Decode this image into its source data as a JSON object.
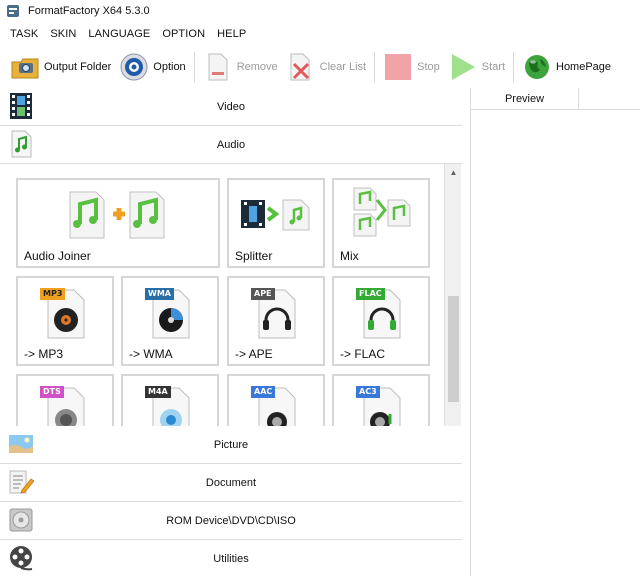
{
  "window": {
    "title": "FormatFactory X64 5.3.0"
  },
  "menu": [
    "TASK",
    "SKIN",
    "LANGUAGE",
    "OPTION",
    "HELP"
  ],
  "toolbar": {
    "output_folder": "Output Folder",
    "option": "Option",
    "remove": "Remove",
    "clear_list": "Clear List",
    "stop": "Stop",
    "start": "Start",
    "homepage": "HomePage"
  },
  "categories": {
    "video": "Video",
    "audio": "Audio",
    "picture": "Picture",
    "document": "Document",
    "rom": "ROM Device\\DVD\\CD\\ISO",
    "utilities": "Utilities"
  },
  "audio_tools": {
    "joiner": "Audio Joiner",
    "splitter": "Splitter",
    "mix": "Mix",
    "mp3": "-> MP3",
    "wma": "-> WMA",
    "ape": "-> APE",
    "flac": "-> FLAC"
  },
  "badges": {
    "mp3": "MP3",
    "wma": "WMA",
    "ape": "APE",
    "flac": "FLAC",
    "dts": "DTS",
    "m4a": "M4A",
    "aac": "AAC",
    "ac3": "AC3"
  },
  "preview": {
    "header": "Preview"
  },
  "colors": {
    "accent_green": "#3fbf3f",
    "mp3_orange": "#f0a020",
    "wma_blue": "#2a6ea6",
    "ape_gray": "#555555",
    "flac_green": "#33aa33",
    "dts_pink": "#d050c8",
    "aac_blue": "#3a78d8"
  }
}
